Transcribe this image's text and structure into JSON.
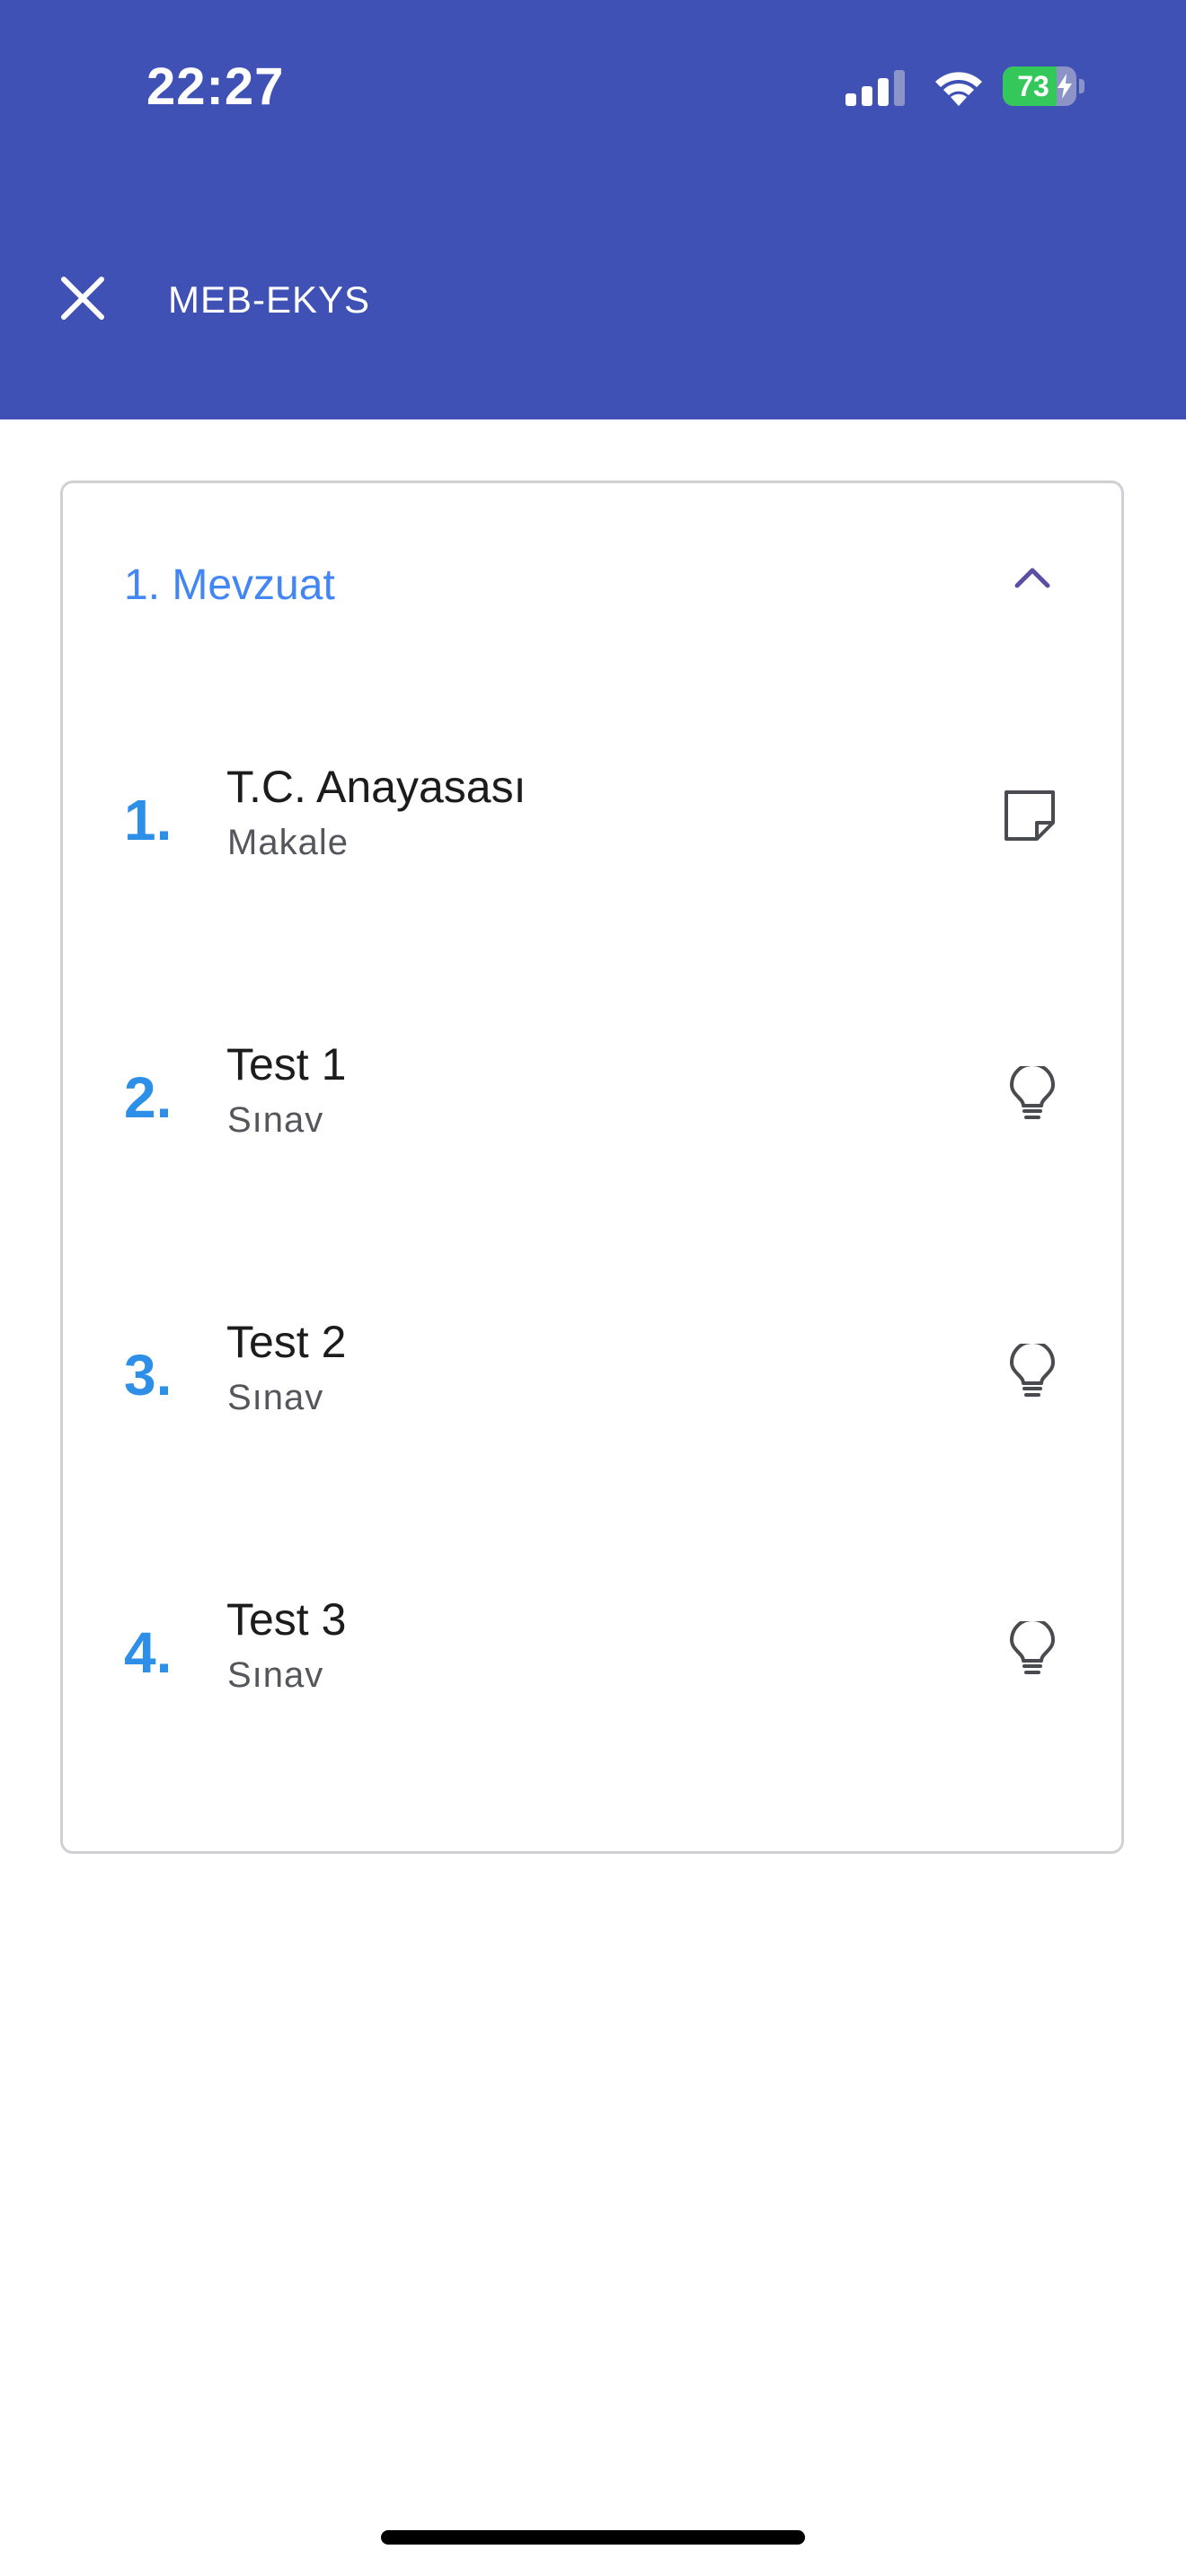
{
  "status_bar": {
    "time": "22:27",
    "battery_level": "73",
    "battery_fraction": 0.73,
    "battery_color": "#34c759"
  },
  "header": {
    "title": "MEB-EKYS",
    "close_icon": "close-icon",
    "background_color": "#3f51b5"
  },
  "section": {
    "title": "1. Mevzuat",
    "expanded": true,
    "toggle_icon": "chevron-up-icon",
    "title_color": "#4285f4"
  },
  "items": [
    {
      "number": "1.",
      "title": "T.C. Anayasası",
      "subtitle": "Makale",
      "icon": "note-icon"
    },
    {
      "number": "2.",
      "title": "Test 1",
      "subtitle": "Sınav",
      "icon": "lightbulb-icon"
    },
    {
      "number": "3.",
      "title": "Test 2",
      "subtitle": "Sınav",
      "icon": "lightbulb-icon"
    },
    {
      "number": "4.",
      "title": "Test 3",
      "subtitle": "Sınav",
      "icon": "lightbulb-icon"
    }
  ]
}
